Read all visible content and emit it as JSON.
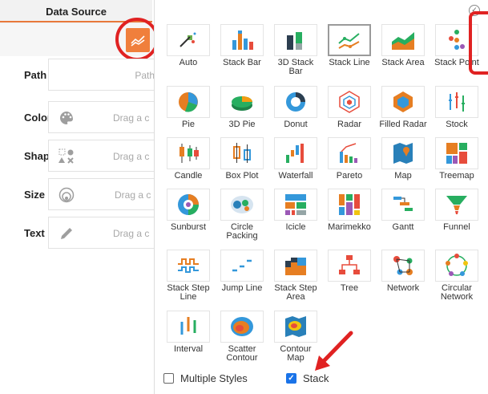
{
  "left_panel": {
    "tab_label": "Data Source",
    "fields": [
      {
        "label": "Path",
        "placeholder": "Path"
      },
      {
        "label": "Color",
        "placeholder": "Drag a c"
      },
      {
        "label": "Shape",
        "placeholder": "Drag a c"
      },
      {
        "label": "Size",
        "placeholder": "Drag a c"
      },
      {
        "label": "Text",
        "placeholder": "Drag a c"
      }
    ]
  },
  "chart_picker": {
    "selected": "Stack Line",
    "types": [
      [
        "Auto"
      ],
      [
        "Stack Bar"
      ],
      [
        "3D Stack",
        "Bar"
      ],
      [
        "Stack Line"
      ],
      [
        "Stack Area"
      ],
      [
        "Stack Point"
      ],
      [
        "Pie"
      ],
      [
        "3D Pie"
      ],
      [
        "Donut"
      ],
      [
        "Radar"
      ],
      [
        "Filled Radar"
      ],
      [
        "Stock"
      ],
      [
        "Candle"
      ],
      [
        "Box Plot"
      ],
      [
        "Waterfall"
      ],
      [
        "Pareto"
      ],
      [
        "Map"
      ],
      [
        "Treemap"
      ],
      [
        "Sunburst"
      ],
      [
        "Circle",
        "Packing"
      ],
      [
        "Icicle"
      ],
      [
        "Marimekko"
      ],
      [
        "Gantt"
      ],
      [
        "Funnel"
      ],
      [
        "Stack Step",
        "Line"
      ],
      [
        "Jump Line"
      ],
      [
        "Stack Step",
        "Area"
      ],
      [
        "Tree"
      ],
      [
        "Network"
      ],
      [
        "Circular",
        "Network"
      ],
      [
        "Interval"
      ],
      [
        "Scatter",
        "Contour"
      ],
      [
        "Contour",
        "Map"
      ]
    ],
    "multiple_styles": {
      "label": "Multiple Styles",
      "checked": false
    },
    "stack": {
      "label": "Stack",
      "checked": true
    }
  },
  "colors": {
    "accent": "#f07f3c",
    "highlight": "#e02222",
    "checkbox": "#1a73e8"
  }
}
